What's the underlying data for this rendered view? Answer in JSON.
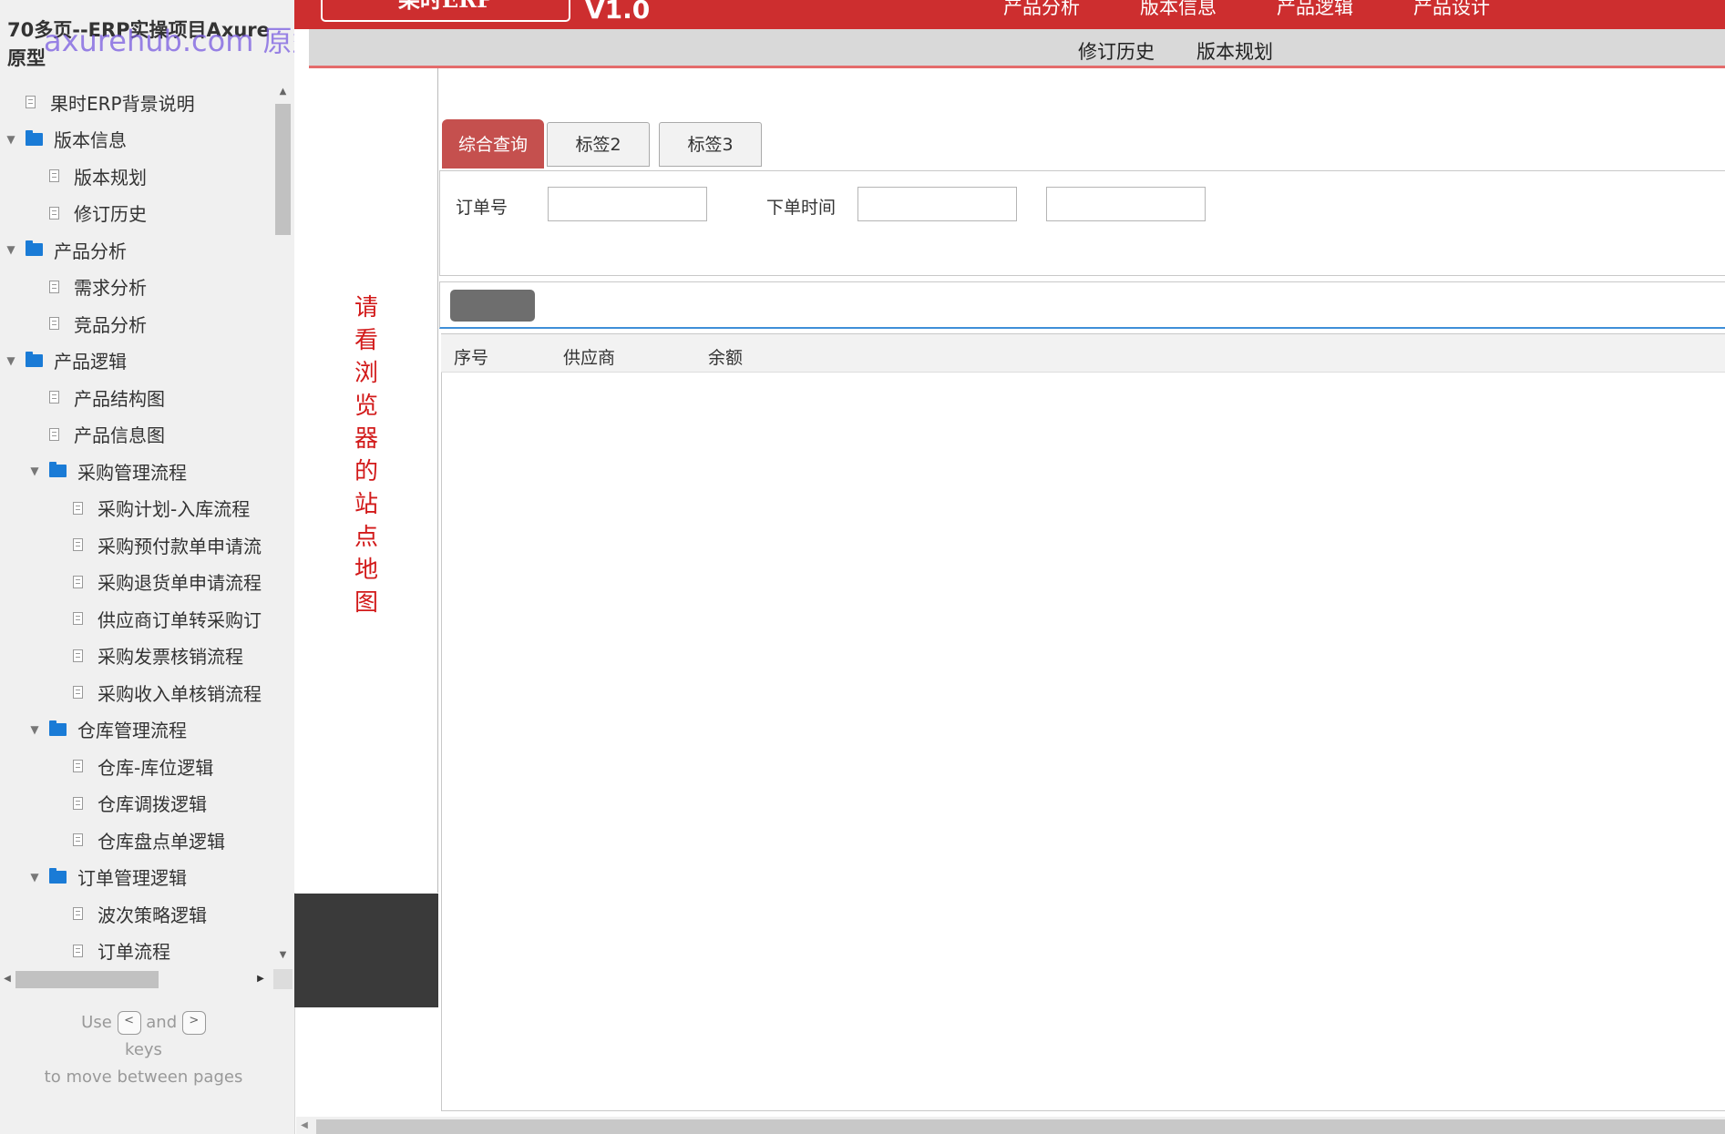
{
  "sidebar": {
    "project_title": "70多页--ERP实操项目Axure原型",
    "watermark": "axurehub.com 原型资源站",
    "tree": [
      {
        "label": "果时ERP背景说明",
        "type": "page",
        "depth": 0
      },
      {
        "label": "版本信息",
        "type": "folder",
        "depth": 0,
        "expanded": true
      },
      {
        "label": "版本规划",
        "type": "page",
        "depth": 1
      },
      {
        "label": "修订历史",
        "type": "page",
        "depth": 1
      },
      {
        "label": "产品分析",
        "type": "folder",
        "depth": 0,
        "expanded": true
      },
      {
        "label": "需求分析",
        "type": "page",
        "depth": 1
      },
      {
        "label": "竞品分析",
        "type": "page",
        "depth": 1
      },
      {
        "label": "产品逻辑",
        "type": "folder",
        "depth": 0,
        "expanded": true
      },
      {
        "label": "产品结构图",
        "type": "page",
        "depth": 1
      },
      {
        "label": "产品信息图",
        "type": "page",
        "depth": 1
      },
      {
        "label": "采购管理流程",
        "type": "folder",
        "depth": 1,
        "expanded": true
      },
      {
        "label": "采购计划-入库流程",
        "type": "page",
        "depth": 2
      },
      {
        "label": "采购预付款单申请流",
        "type": "page",
        "depth": 2
      },
      {
        "label": "采购退货单申请流程",
        "type": "page",
        "depth": 2
      },
      {
        "label": "供应商订单转采购订",
        "type": "page",
        "depth": 2
      },
      {
        "label": "采购发票核销流程",
        "type": "page",
        "depth": 2
      },
      {
        "label": "采购收入单核销流程",
        "type": "page",
        "depth": 2
      },
      {
        "label": "仓库管理流程",
        "type": "folder",
        "depth": 1,
        "expanded": true
      },
      {
        "label": "仓库-库位逻辑",
        "type": "page",
        "depth": 2
      },
      {
        "label": "仓库调拨逻辑",
        "type": "page",
        "depth": 2
      },
      {
        "label": "仓库盘点单逻辑",
        "type": "page",
        "depth": 2
      },
      {
        "label": "订单管理逻辑",
        "type": "folder",
        "depth": 1,
        "expanded": true
      },
      {
        "label": "波次策略逻辑",
        "type": "page",
        "depth": 2
      },
      {
        "label": "订单流程",
        "type": "page",
        "depth": 2
      }
    ],
    "nav_hint": {
      "use": "Use",
      "prev_key": "<",
      "and": "and",
      "next_key": ">",
      "keys": "keys",
      "rest": "to move between pages"
    }
  },
  "header": {
    "logo": "果时ERP",
    "version": "V1.0",
    "nav": [
      "产品分析",
      "版本信息",
      "产品逻辑",
      "产品设计"
    ],
    "sub_nav": [
      "修订历史",
      "版本规划"
    ],
    "accent_color": "#cd2e2f"
  },
  "hint_text": "请看浏览器的站点地图",
  "tabs": [
    "综合查询",
    "标签2",
    "标签3"
  ],
  "query": {
    "order_no_label": "订单号",
    "order_time_label": "下单时间",
    "order_no_value": "",
    "time_from_value": "",
    "time_to_value": ""
  },
  "table": {
    "columns": [
      "序号",
      "供应商",
      "余额"
    ],
    "rows": []
  }
}
